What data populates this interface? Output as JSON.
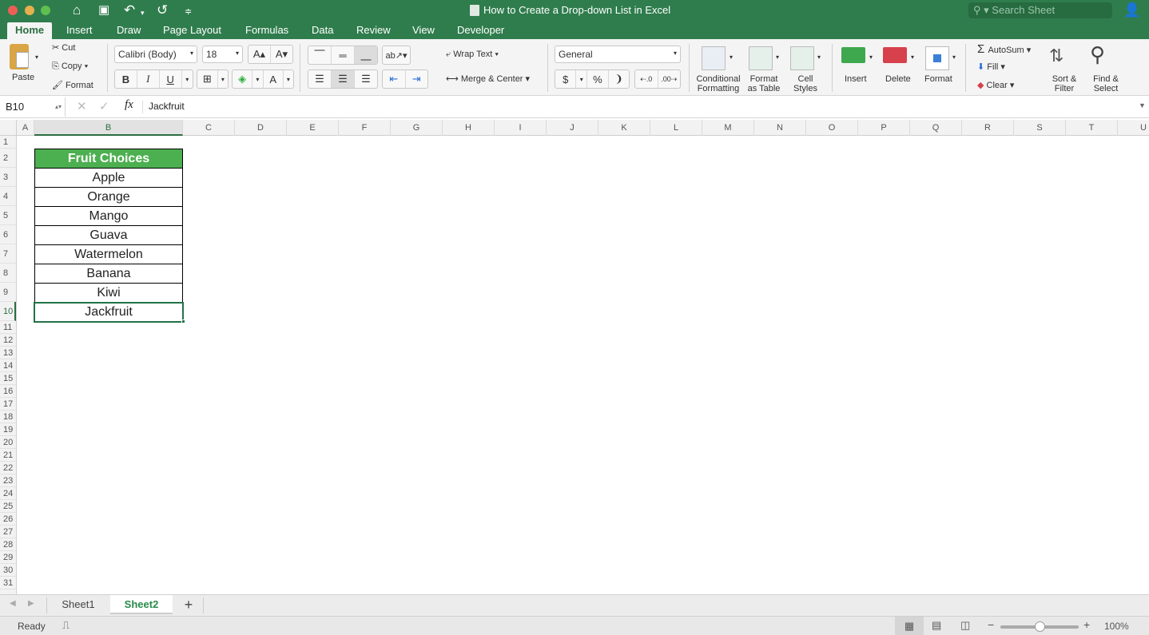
{
  "window": {
    "title": "How to Create a Drop-down List in Excel",
    "search_placeholder": "Search Sheet"
  },
  "quick_access": [
    "home-icon",
    "save-icon",
    "undo-icon",
    "redo-icon",
    "customize-icon"
  ],
  "ribbon_tabs": [
    "Home",
    "Insert",
    "Draw",
    "Page Layout",
    "Formulas",
    "Data",
    "Review",
    "View",
    "Developer"
  ],
  "active_tab": "Home",
  "share_label": "Share",
  "clipboard": {
    "paste": "Paste",
    "cut": "Cut",
    "copy": "Copy",
    "format": "Format"
  },
  "font": {
    "name": "Calibri (Body)",
    "size": "18",
    "bold": "B",
    "italic": "I",
    "underline": "U"
  },
  "alignment": {
    "wrap_text": "Wrap Text",
    "merge_center": "Merge & Center"
  },
  "number": {
    "format": "General",
    "currency": "$",
    "percent": "%",
    "comma": "❩"
  },
  "styles": {
    "conditional": [
      "Conditional",
      "Formatting"
    ],
    "format_table": [
      "Format",
      "as Table"
    ],
    "cell_styles": [
      "Cell",
      "Styles"
    ]
  },
  "cells": {
    "insert": "Insert",
    "delete": "Delete",
    "format": "Format"
  },
  "editing": {
    "autosum": "AutoSum",
    "fill": "Fill",
    "clear": "Clear",
    "sort": [
      "Sort &",
      "Filter"
    ],
    "find": [
      "Find &",
      "Select"
    ]
  },
  "formula_bar": {
    "name_box": "B10",
    "fx": "fx",
    "value": "Jackfruit"
  },
  "columns": [
    "A",
    "B",
    "C",
    "D",
    "E",
    "F",
    "G",
    "H",
    "I",
    "J",
    "K",
    "L",
    "M",
    "N",
    "O",
    "P",
    "Q",
    "R",
    "S",
    "T",
    "U"
  ],
  "selected_column": "B",
  "selected_row": 10,
  "rows": [
    "1",
    "2",
    "3",
    "4",
    "5",
    "6",
    "7",
    "8",
    "9",
    "10",
    "11",
    "12",
    "13",
    "14",
    "15",
    "16",
    "17",
    "18",
    "19",
    "20",
    "21",
    "22",
    "23",
    "24",
    "25",
    "26",
    "27",
    "28",
    "29",
    "30",
    "31"
  ],
  "table": {
    "header": "Fruit Choices",
    "items": [
      "Apple",
      "Orange",
      "Mango",
      "Guava",
      "Watermelon",
      "Banana",
      "Kiwi",
      "Jackfruit"
    ]
  },
  "sheets": [
    "Sheet1",
    "Sheet2"
  ],
  "active_sheet": "Sheet2",
  "status": {
    "text": "Ready",
    "zoom": "100%",
    "zoom_percent": 100
  },
  "colors": {
    "accent": "#217346",
    "titlebar": "#2f7d4d",
    "table_header": "#4caf50"
  }
}
